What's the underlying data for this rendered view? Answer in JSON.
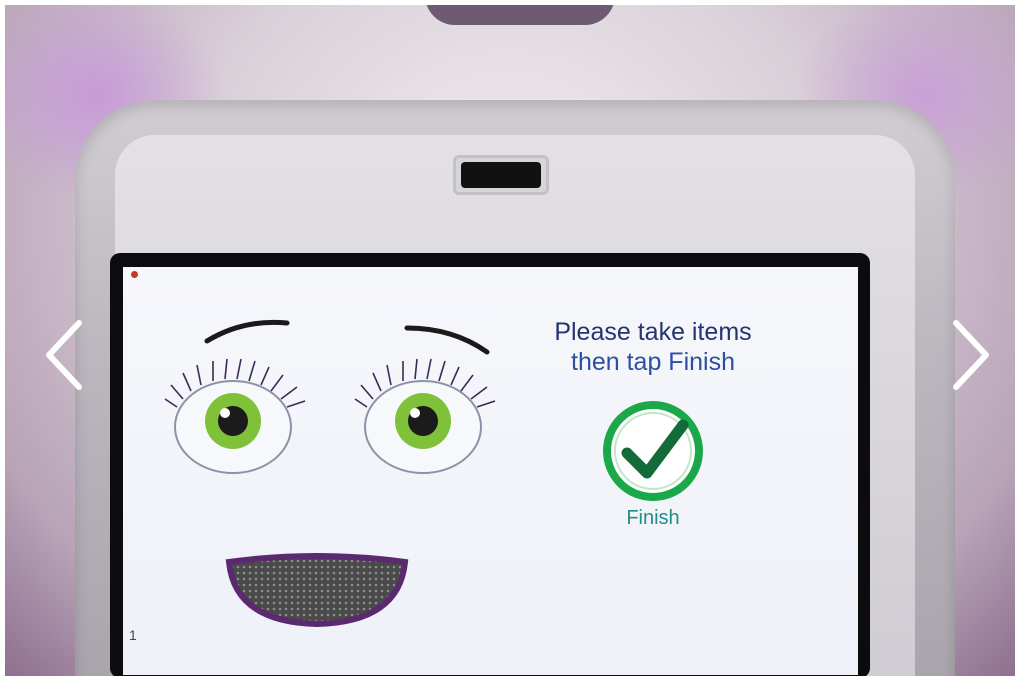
{
  "screen": {
    "status_text": "",
    "message_line1": "Please take items",
    "message_line2": "then tap Finish",
    "finish_label": "Finish",
    "page_number": "1"
  },
  "carousel": {
    "prev_icon": "chevron-left-icon",
    "next_icon": "chevron-right-icon"
  },
  "colors": {
    "message_dark": "#25346e",
    "message_accent": "#2d4fa0",
    "finish_green": "#16a34a",
    "iris_green": "#7fc23a",
    "mouth_purple": "#5b2a6e"
  }
}
